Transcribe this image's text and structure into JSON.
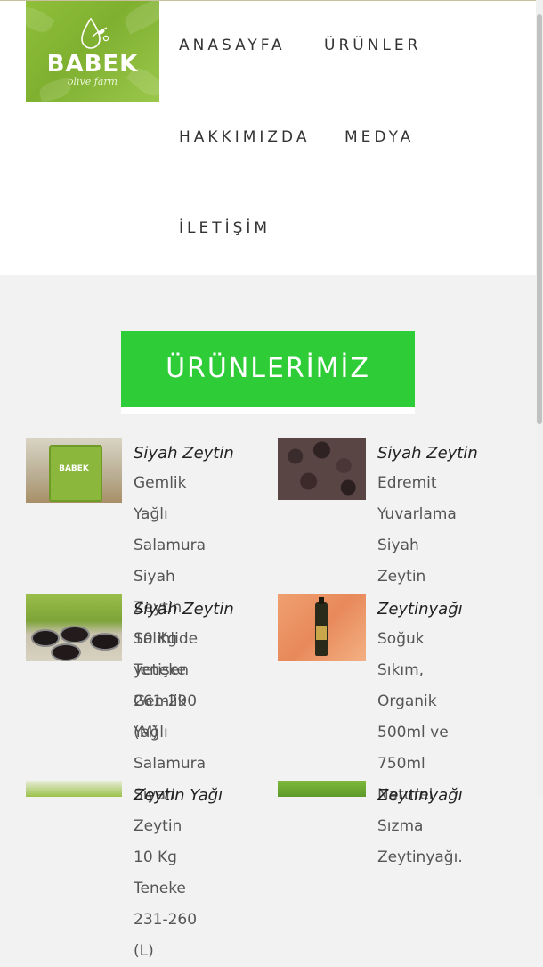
{
  "brand": {
    "name": "BABEK",
    "tagline": "olive farm"
  },
  "nav": {
    "home": "ANASAYFA",
    "products": "ÜRÜNLER",
    "about": "HAKKIMIZDA",
    "media": "MEDYA",
    "contact": "İLETİŞİM"
  },
  "section": {
    "title": "ÜRÜNLERİMİZ"
  },
  "products": [
    {
      "title": "Siyah Zeytin",
      "lines": [
        "Gemlik Yağlı",
        "Salamura Siyah",
        "Zeytin 10 Kg Teneke",
        "261-290 (M)"
      ]
    },
    {
      "title": "Siyah Zeytin",
      "lines": [
        "Edremit",
        "Yuvarlama Siyah",
        "Zeytin"
      ]
    },
    {
      "title": "Siyah Zeytin",
      "lines": [
        "Salihlide yetişen",
        "Gemlik Yağlı",
        "Salamura Siyah",
        "Zeytin 10 Kg Teneke",
        "231-260 (L)"
      ]
    },
    {
      "title": "Zeytinyağı",
      "lines": [
        "Soğuk Sıkım,",
        "Organik 500ml ve",
        "750ml Naturel",
        "Sızma Zeytinyağı."
      ]
    },
    {
      "title": "Zeytin Yağı",
      "lines": []
    },
    {
      "title": "Zeytinyağı",
      "lines": []
    }
  ],
  "colors": {
    "accent": "#2ecc37",
    "logo_green": "#8fbf3a"
  }
}
